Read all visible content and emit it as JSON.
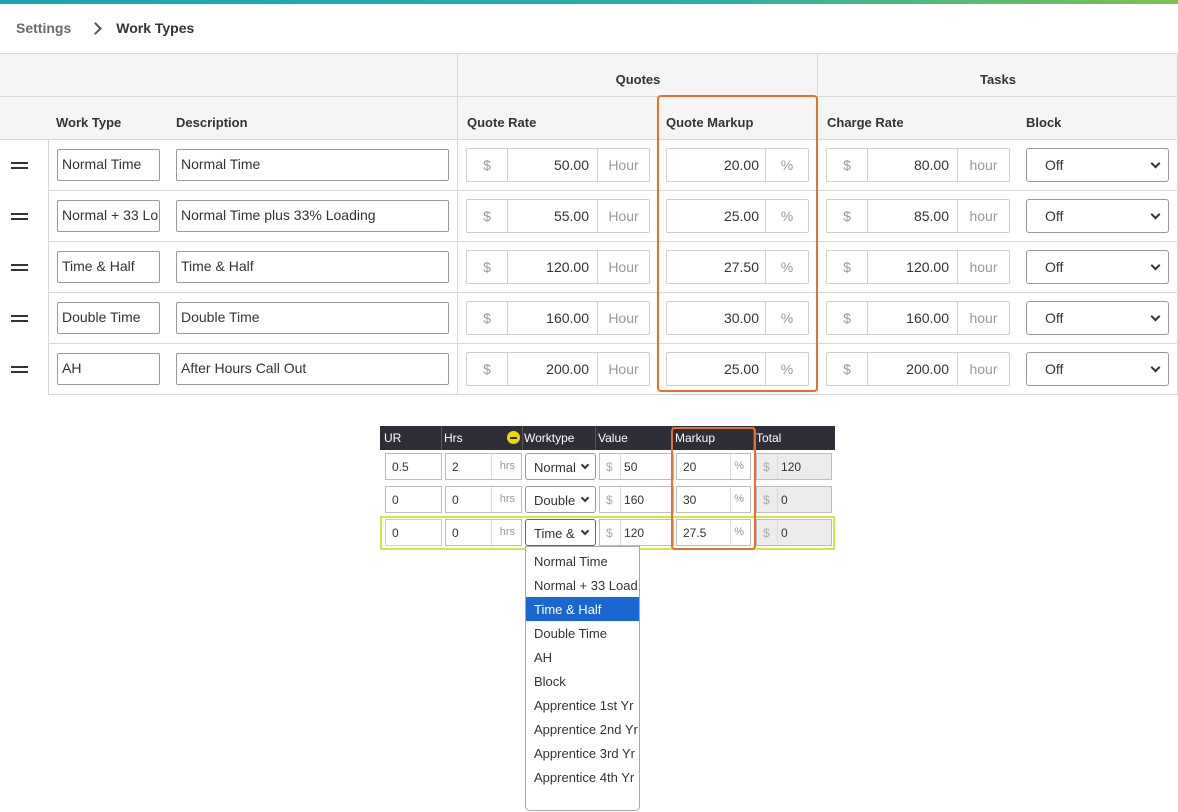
{
  "breadcrumb": {
    "parent": "Settings",
    "current": "Work Types"
  },
  "groups": {
    "quotes": "Quotes",
    "tasks": "Tasks"
  },
  "columns": {
    "work_type": "Work Type",
    "description": "Description",
    "quote_rate": "Quote Rate",
    "quote_markup": "Quote Markup",
    "charge_rate": "Charge Rate",
    "block": "Block"
  },
  "work_types": [
    {
      "name": "Normal Time",
      "description": "Normal Time",
      "quote_rate": "50.00",
      "quote_unit": "Hour",
      "markup": "20.00",
      "markup_unit": "%",
      "charge_rate": "80.00",
      "charge_unit": "hour",
      "block": "Off"
    },
    {
      "name": "Normal + 33 Lo",
      "description": "Normal Time plus 33% Loading",
      "quote_rate": "55.00",
      "quote_unit": "Hour",
      "markup": "25.00",
      "markup_unit": "%",
      "charge_rate": "85.00",
      "charge_unit": "hour",
      "block": "Off"
    },
    {
      "name": "Time & Half",
      "description": "Time & Half",
      "quote_rate": "120.00",
      "quote_unit": "Hour",
      "markup": "27.50",
      "markup_unit": "%",
      "charge_rate": "120.00",
      "charge_unit": "hour",
      "block": "Off"
    },
    {
      "name": "Double Time",
      "description": "Double Time",
      "quote_rate": "160.00",
      "quote_unit": "Hour",
      "markup": "30.00",
      "markup_unit": "%",
      "charge_rate": "160.00",
      "charge_unit": "hour",
      "block": "Off"
    },
    {
      "name": "AH",
      "description": "After Hours Call Out",
      "quote_rate": "200.00",
      "quote_unit": "Hour",
      "markup": "25.00",
      "markup_unit": "%",
      "charge_rate": "200.00",
      "charge_unit": "hour",
      "block": "Off"
    }
  ],
  "currency_symbol": "$",
  "quote_lines": {
    "headers": {
      "ur": "UR",
      "hrs": "Hrs",
      "worktype": "Worktype",
      "value": "Value",
      "markup": "Markup",
      "total": "Total"
    },
    "hrs_unit": "hrs",
    "markup_unit": "%",
    "rows": [
      {
        "ur": "0.5",
        "hrs": "2",
        "worktype": "Normal",
        "value": "50",
        "markup": "20",
        "total": "120"
      },
      {
        "ur": "0",
        "hrs": "0",
        "worktype": "Double",
        "value": "160",
        "markup": "30",
        "total": "0"
      },
      {
        "ur": "0",
        "hrs": "0",
        "worktype": "Time &",
        "value": "120",
        "markup": "27.5",
        "total": "0"
      }
    ]
  },
  "worktype_options": [
    "Normal Time",
    "Normal + 33 Load",
    "Time & Half",
    "Double Time",
    "AH",
    "Block",
    "Apprentice 1st Yr",
    "Apprentice 2nd Yr",
    "Apprentice 3rd Yr",
    "Apprentice 4th Yr"
  ],
  "selected_option": "Time & Half",
  "colors": {
    "highlight": "#e8702a",
    "active_row": "#d8e34a",
    "selected_option": "#1a66d2"
  }
}
